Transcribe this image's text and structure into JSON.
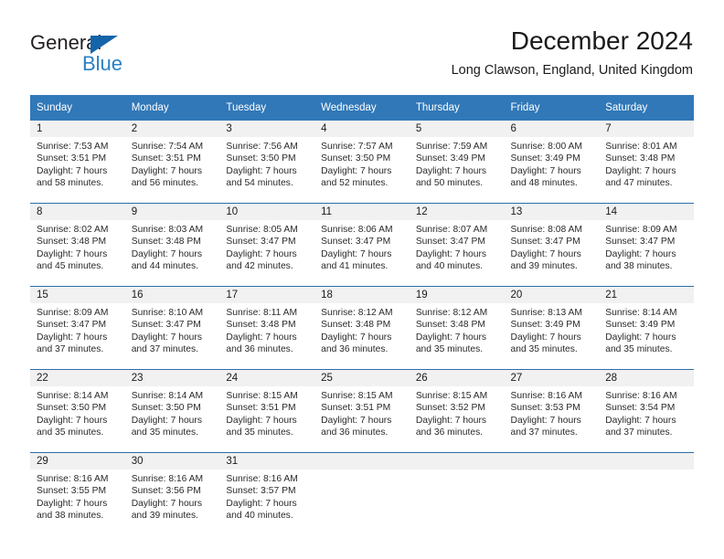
{
  "logo": {
    "word_top": "General",
    "word_bottom": "Blue",
    "triangle_icon": "triangle-icon",
    "brand_blue": "#2980c4",
    "triangle_blue": "#1464aa"
  },
  "header": {
    "title": "December 2024",
    "subtitle": "Long Clawson, England, United Kingdom"
  },
  "theme": {
    "header_blue": "#3178b8",
    "row_divider_blue": "#2e6da8",
    "daynum_band": "#f1f1f1",
    "text": "#1a1a1a"
  },
  "calendar": {
    "weekday_headers": [
      "Sunday",
      "Monday",
      "Tuesday",
      "Wednesday",
      "Thursday",
      "Friday",
      "Saturday"
    ],
    "weeks": [
      [
        {
          "day": "1",
          "sunrise": "Sunrise: 7:53 AM",
          "sunset": "Sunset: 3:51 PM",
          "daylight_line1": "Daylight: 7 hours",
          "daylight_line2": "and 58 minutes."
        },
        {
          "day": "2",
          "sunrise": "Sunrise: 7:54 AM",
          "sunset": "Sunset: 3:51 PM",
          "daylight_line1": "Daylight: 7 hours",
          "daylight_line2": "and 56 minutes."
        },
        {
          "day": "3",
          "sunrise": "Sunrise: 7:56 AM",
          "sunset": "Sunset: 3:50 PM",
          "daylight_line1": "Daylight: 7 hours",
          "daylight_line2": "and 54 minutes."
        },
        {
          "day": "4",
          "sunrise": "Sunrise: 7:57 AM",
          "sunset": "Sunset: 3:50 PM",
          "daylight_line1": "Daylight: 7 hours",
          "daylight_line2": "and 52 minutes."
        },
        {
          "day": "5",
          "sunrise": "Sunrise: 7:59 AM",
          "sunset": "Sunset: 3:49 PM",
          "daylight_line1": "Daylight: 7 hours",
          "daylight_line2": "and 50 minutes."
        },
        {
          "day": "6",
          "sunrise": "Sunrise: 8:00 AM",
          "sunset": "Sunset: 3:49 PM",
          "daylight_line1": "Daylight: 7 hours",
          "daylight_line2": "and 48 minutes."
        },
        {
          "day": "7",
          "sunrise": "Sunrise: 8:01 AM",
          "sunset": "Sunset: 3:48 PM",
          "daylight_line1": "Daylight: 7 hours",
          "daylight_line2": "and 47 minutes."
        }
      ],
      [
        {
          "day": "8",
          "sunrise": "Sunrise: 8:02 AM",
          "sunset": "Sunset: 3:48 PM",
          "daylight_line1": "Daylight: 7 hours",
          "daylight_line2": "and 45 minutes."
        },
        {
          "day": "9",
          "sunrise": "Sunrise: 8:03 AM",
          "sunset": "Sunset: 3:48 PM",
          "daylight_line1": "Daylight: 7 hours",
          "daylight_line2": "and 44 minutes."
        },
        {
          "day": "10",
          "sunrise": "Sunrise: 8:05 AM",
          "sunset": "Sunset: 3:47 PM",
          "daylight_line1": "Daylight: 7 hours",
          "daylight_line2": "and 42 minutes."
        },
        {
          "day": "11",
          "sunrise": "Sunrise: 8:06 AM",
          "sunset": "Sunset: 3:47 PM",
          "daylight_line1": "Daylight: 7 hours",
          "daylight_line2": "and 41 minutes."
        },
        {
          "day": "12",
          "sunrise": "Sunrise: 8:07 AM",
          "sunset": "Sunset: 3:47 PM",
          "daylight_line1": "Daylight: 7 hours",
          "daylight_line2": "and 40 minutes."
        },
        {
          "day": "13",
          "sunrise": "Sunrise: 8:08 AM",
          "sunset": "Sunset: 3:47 PM",
          "daylight_line1": "Daylight: 7 hours",
          "daylight_line2": "and 39 minutes."
        },
        {
          "day": "14",
          "sunrise": "Sunrise: 8:09 AM",
          "sunset": "Sunset: 3:47 PM",
          "daylight_line1": "Daylight: 7 hours",
          "daylight_line2": "and 38 minutes."
        }
      ],
      [
        {
          "day": "15",
          "sunrise": "Sunrise: 8:09 AM",
          "sunset": "Sunset: 3:47 PM",
          "daylight_line1": "Daylight: 7 hours",
          "daylight_line2": "and 37 minutes."
        },
        {
          "day": "16",
          "sunrise": "Sunrise: 8:10 AM",
          "sunset": "Sunset: 3:47 PM",
          "daylight_line1": "Daylight: 7 hours",
          "daylight_line2": "and 37 minutes."
        },
        {
          "day": "17",
          "sunrise": "Sunrise: 8:11 AM",
          "sunset": "Sunset: 3:48 PM",
          "daylight_line1": "Daylight: 7 hours",
          "daylight_line2": "and 36 minutes."
        },
        {
          "day": "18",
          "sunrise": "Sunrise: 8:12 AM",
          "sunset": "Sunset: 3:48 PM",
          "daylight_line1": "Daylight: 7 hours",
          "daylight_line2": "and 36 minutes."
        },
        {
          "day": "19",
          "sunrise": "Sunrise: 8:12 AM",
          "sunset": "Sunset: 3:48 PM",
          "daylight_line1": "Daylight: 7 hours",
          "daylight_line2": "and 35 minutes."
        },
        {
          "day": "20",
          "sunrise": "Sunrise: 8:13 AM",
          "sunset": "Sunset: 3:49 PM",
          "daylight_line1": "Daylight: 7 hours",
          "daylight_line2": "and 35 minutes."
        },
        {
          "day": "21",
          "sunrise": "Sunrise: 8:14 AM",
          "sunset": "Sunset: 3:49 PM",
          "daylight_line1": "Daylight: 7 hours",
          "daylight_line2": "and 35 minutes."
        }
      ],
      [
        {
          "day": "22",
          "sunrise": "Sunrise: 8:14 AM",
          "sunset": "Sunset: 3:50 PM",
          "daylight_line1": "Daylight: 7 hours",
          "daylight_line2": "and 35 minutes."
        },
        {
          "day": "23",
          "sunrise": "Sunrise: 8:14 AM",
          "sunset": "Sunset: 3:50 PM",
          "daylight_line1": "Daylight: 7 hours",
          "daylight_line2": "and 35 minutes."
        },
        {
          "day": "24",
          "sunrise": "Sunrise: 8:15 AM",
          "sunset": "Sunset: 3:51 PM",
          "daylight_line1": "Daylight: 7 hours",
          "daylight_line2": "and 35 minutes."
        },
        {
          "day": "25",
          "sunrise": "Sunrise: 8:15 AM",
          "sunset": "Sunset: 3:51 PM",
          "daylight_line1": "Daylight: 7 hours",
          "daylight_line2": "and 36 minutes."
        },
        {
          "day": "26",
          "sunrise": "Sunrise: 8:15 AM",
          "sunset": "Sunset: 3:52 PM",
          "daylight_line1": "Daylight: 7 hours",
          "daylight_line2": "and 36 minutes."
        },
        {
          "day": "27",
          "sunrise": "Sunrise: 8:16 AM",
          "sunset": "Sunset: 3:53 PM",
          "daylight_line1": "Daylight: 7 hours",
          "daylight_line2": "and 37 minutes."
        },
        {
          "day": "28",
          "sunrise": "Sunrise: 8:16 AM",
          "sunset": "Sunset: 3:54 PM",
          "daylight_line1": "Daylight: 7 hours",
          "daylight_line2": "and 37 minutes."
        }
      ],
      [
        {
          "day": "29",
          "sunrise": "Sunrise: 8:16 AM",
          "sunset": "Sunset: 3:55 PM",
          "daylight_line1": "Daylight: 7 hours",
          "daylight_line2": "and 38 minutes."
        },
        {
          "day": "30",
          "sunrise": "Sunrise: 8:16 AM",
          "sunset": "Sunset: 3:56 PM",
          "daylight_line1": "Daylight: 7 hours",
          "daylight_line2": "and 39 minutes."
        },
        {
          "day": "31",
          "sunrise": "Sunrise: 8:16 AM",
          "sunset": "Sunset: 3:57 PM",
          "daylight_line1": "Daylight: 7 hours",
          "daylight_line2": "and 40 minutes."
        },
        {
          "day": "",
          "sunrise": "",
          "sunset": "",
          "daylight_line1": "",
          "daylight_line2": ""
        },
        {
          "day": "",
          "sunrise": "",
          "sunset": "",
          "daylight_line1": "",
          "daylight_line2": ""
        },
        {
          "day": "",
          "sunrise": "",
          "sunset": "",
          "daylight_line1": "",
          "daylight_line2": ""
        },
        {
          "day": "",
          "sunrise": "",
          "sunset": "",
          "daylight_line1": "",
          "daylight_line2": ""
        }
      ]
    ]
  }
}
